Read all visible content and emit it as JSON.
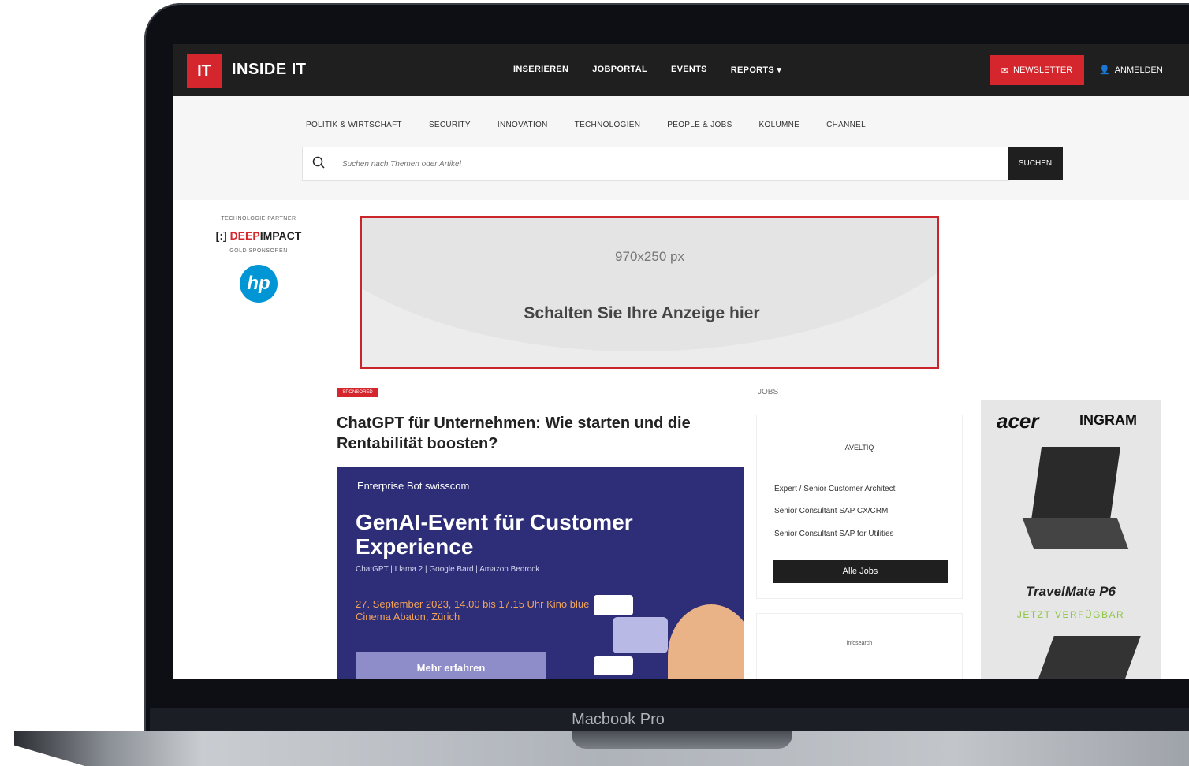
{
  "device": {
    "label": "Macbook Pro"
  },
  "header": {
    "logo_badge": "IT",
    "logo_text": "INSIDE IT",
    "nav": [
      "INSERIEREN",
      "JOBPORTAL",
      "EVENTS",
      "REPORTS ▾"
    ],
    "newsletter_label": "NEWSLETTER",
    "login_label": "ANMELDEN"
  },
  "subnav": [
    "POLITIK & WIRTSCHAFT",
    "SECURITY",
    "INNOVATION",
    "TECHNOLOGIEN",
    "PEOPLE & JOBS",
    "KOLUMNE",
    "CHANNEL"
  ],
  "search": {
    "placeholder": "Suchen nach Themen oder Artikel",
    "button_label": "SUCHEN"
  },
  "sponsors": {
    "tech_partner_label": "TECHNOLOGIE PARTNER",
    "tech_partner_brand_a": "DEEP",
    "tech_partner_brand_b": "IMPACT",
    "gold_label": "GOLD SPONSOREN",
    "gold_logo": "hp"
  },
  "ad": {
    "size": "970x250 px",
    "cta": "Schalten Sie Ihre Anzeige hier"
  },
  "article": {
    "badge": "SPONSORED",
    "title": "ChatGPT für Unternehmen: Wie starten und die Rentabilität boosten?",
    "promo": {
      "brands": "Enterprise Bot  swisscom",
      "headline": "GenAI-Event für Customer Experience",
      "subline": "ChatGPT | Llama 2 | Google Bard | Amazon Bedrock",
      "date": "27. September 2023, 14.00 bis 17.15 Uhr Kino blue Cinema Abaton, Zürich",
      "button_label": "Mehr erfahren"
    }
  },
  "jobs": {
    "label": "JOBS",
    "company": "AVELTIQ",
    "items": [
      "Expert / Senior Customer Architect",
      "Senior Consultant SAP CX/CRM",
      "Senior Consultant SAP for Utilities"
    ],
    "all_label": "Alle Jobs",
    "second_company": "infosearch"
  },
  "side_ad": {
    "brand": "acer",
    "partner": "INGRAM",
    "product": "TravelMate P6",
    "tagline": "JETZT VERFÜGBAR"
  },
  "colors": {
    "brand_red": "#d4262c",
    "dark": "#1f1f1f",
    "promo_bg": "#2e2d78",
    "available_green": "#8cc63f"
  }
}
